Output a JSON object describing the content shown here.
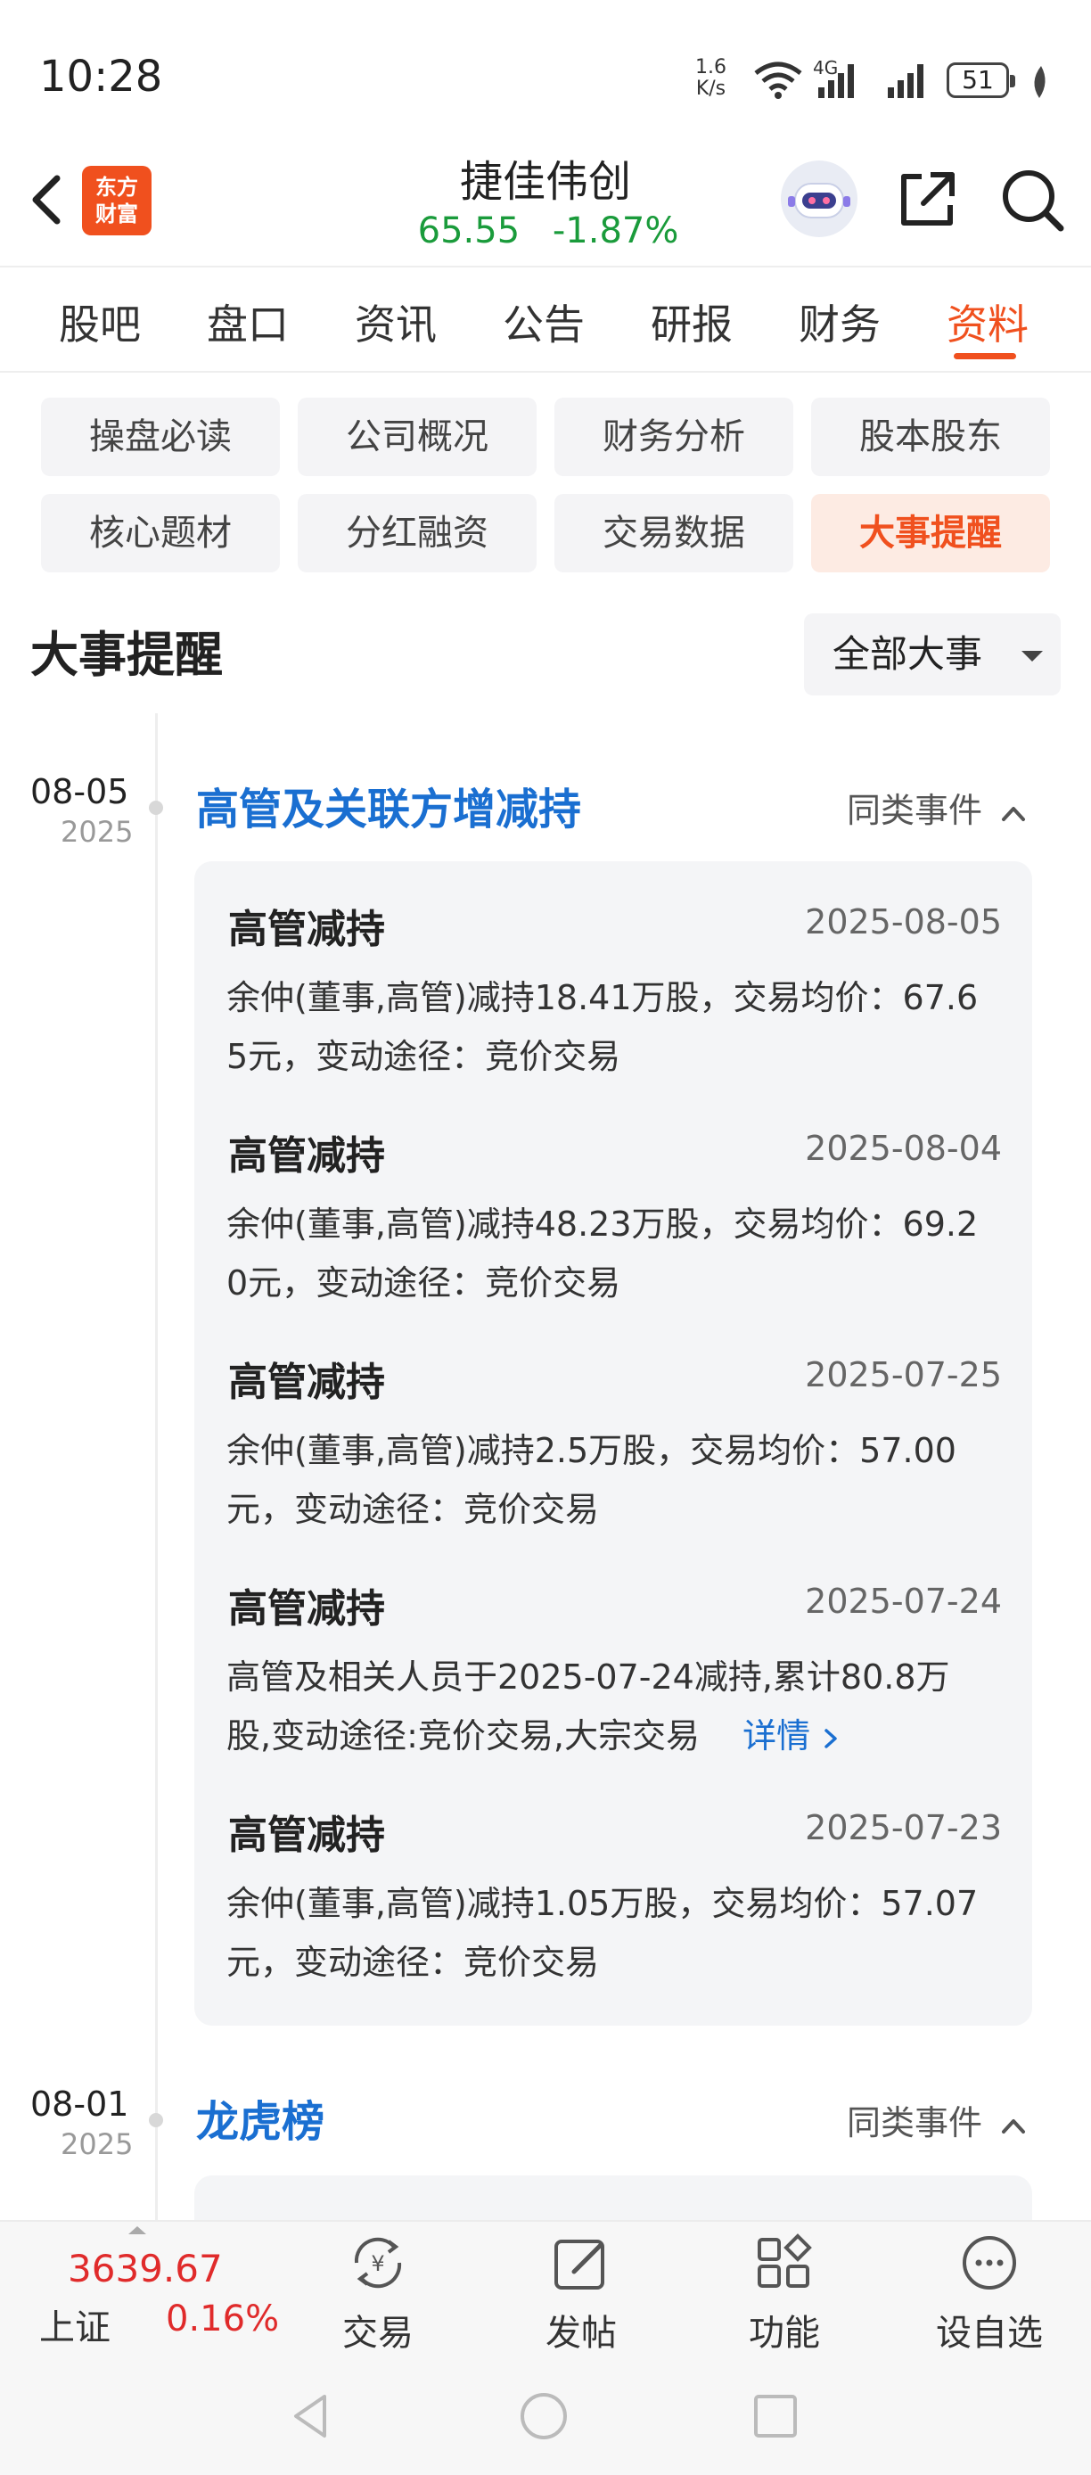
{
  "status_bar": {
    "time": "10:28",
    "speed_value": "1.6",
    "speed_unit": "K/s",
    "network": "4G",
    "battery": "51"
  },
  "header": {
    "logo_line1": "东方",
    "logo_line2": "财富",
    "stock_name": "捷佳伟创",
    "price": "65.55",
    "change": "-1.87%"
  },
  "tabs": [
    "股吧",
    "盘口",
    "资讯",
    "公告",
    "研报",
    "财务",
    "资料"
  ],
  "active_tab": "资料",
  "sub_nav": [
    "操盘必读",
    "公司概况",
    "财务分析",
    "股本股东",
    "核心题材",
    "分红融资",
    "交易数据",
    "大事提醒"
  ],
  "active_sub_nav": "大事提醒",
  "section": {
    "title": "大事提醒",
    "filter": "全部大事"
  },
  "events": [
    {
      "date": "08-05",
      "year": "2025",
      "title": "高管及关联方增减持",
      "same_type": "同类事件",
      "items": [
        {
          "title": "高管减持",
          "date": "2025-08-05",
          "line1": "余仲(董事,高管)减持18.41万股，交易均价：67.6",
          "line2": "5元，变动途径：竞价交易"
        },
        {
          "title": "高管减持",
          "date": "2025-08-04",
          "line1": "余仲(董事,高管)减持48.23万股，交易均价：69.2",
          "line2": "0元，变动途径：竞价交易"
        },
        {
          "title": "高管减持",
          "date": "2025-07-25",
          "line1": "余仲(董事,高管)减持2.5万股，交易均价：57.00",
          "line2": "元，变动途径：竞价交易"
        },
        {
          "title": "高管减持",
          "date": "2025-07-24",
          "line1": "高管及相关人员于2025-07-24减持,累计80.8万",
          "line2": "股,变动途径:竞价交易,大宗交易",
          "detail": "详情"
        },
        {
          "title": "高管减持",
          "date": "2025-07-23",
          "line1": "余仲(董事,高管)减持1.05万股，交易均价：57.07",
          "line2": "元，变动途径：竞价交易"
        }
      ]
    },
    {
      "date": "08-01",
      "year": "2025",
      "title": "龙虎榜",
      "same_type": "同类事件"
    }
  ],
  "bottom_bar": {
    "index_value": "3639.67",
    "index_name": "上证",
    "index_change": "0.16%",
    "items": [
      "交易",
      "发帖",
      "功能",
      "设自选"
    ]
  },
  "colors": {
    "accent": "#f0501e",
    "link": "#1a6fd1",
    "down": "#1a9b3b",
    "up": "#e02b2b"
  }
}
